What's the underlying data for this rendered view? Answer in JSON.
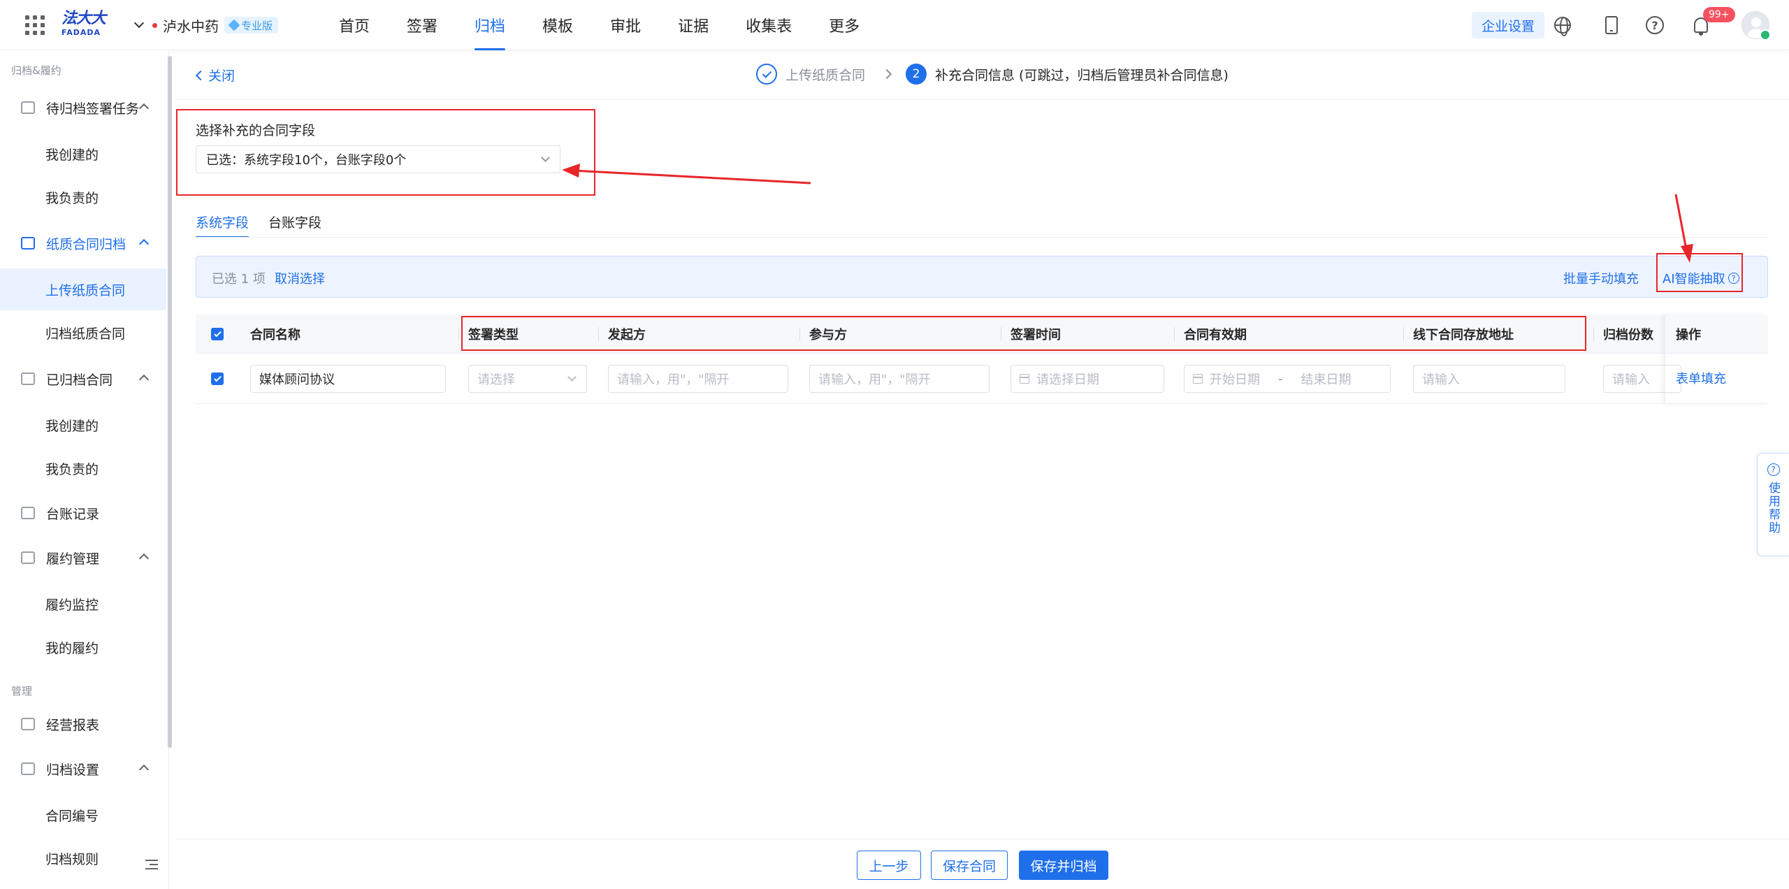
{
  "topbar": {
    "logo_cn": "法大大",
    "logo_en": "FADADA",
    "org_name": "泸水中药",
    "edition_badge": "专业版",
    "nav": [
      "首页",
      "签署",
      "归档",
      "模板",
      "审批",
      "证据",
      "收集表",
      "更多"
    ],
    "active_nav": "归档",
    "enterprise_settings": "企业设置",
    "notification_count": "99+"
  },
  "sidebar": {
    "group1_title": "归档&履约",
    "pending_tasks": "待归档签署任务",
    "pending_created": "我创建的",
    "pending_responsible": "我负责的",
    "paper_archive": "纸质合同归档",
    "upload_paper": "上传纸质合同",
    "archive_paper": "归档纸质合同",
    "archived_contracts": "已归档合同",
    "archived_created": "我创建的",
    "archived_responsible": "我负责的",
    "ledger_records": "台账记录",
    "performance_mgmt": "履约管理",
    "performance_monitor": "履约监控",
    "my_performance": "我的履约",
    "group2_title": "管理",
    "business_report": "经营报表",
    "archive_settings": "归档设置",
    "contract_numbering": "合同编号",
    "archive_rules": "归档规则"
  },
  "main": {
    "close_label": "关闭",
    "step1": "上传纸质合同",
    "step2_num": "2",
    "step2": "补充合同信息 (可跳过，归档后管理员补合同信息)",
    "field_label": "选择补充的合同字段",
    "field_value": "已选：系统字段10个，台账字段0个",
    "tabs": [
      "系统字段",
      "台账字段"
    ],
    "selection": {
      "count": "已选 1 项",
      "cancel": "取消选择",
      "batch_fill": "批量手动填充",
      "ai_extract": "AI智能抽取"
    },
    "table": {
      "headers": [
        "合同名称",
        "签署类型",
        "发起方",
        "参与方",
        "签署时间",
        "合同有效期",
        "线下合同存放地址",
        "归档份数",
        "操作"
      ],
      "row": {
        "contract_name": "媒体顾问协议",
        "sign_type_placeholder": "请选择",
        "initiator_placeholder": "请输入，用\"，\"隔开",
        "participant_placeholder": "请输入，用\"，\"隔开",
        "sign_time_placeholder": "请选择日期",
        "start_date_placeholder": "开始日期",
        "range_separator": "-",
        "end_date_placeholder": "结束日期",
        "address_placeholder": "请输入",
        "copies_placeholder": "请输入",
        "action": "表单填充"
      }
    }
  },
  "help_float": {
    "label": "使用帮助"
  },
  "footer": {
    "prev": "上一步",
    "save": "保存合同",
    "save_archive": "保存并归档"
  },
  "colors": {
    "accent": "#1f6feb",
    "annotation": "#e8262a",
    "badge": "#f5515f"
  }
}
